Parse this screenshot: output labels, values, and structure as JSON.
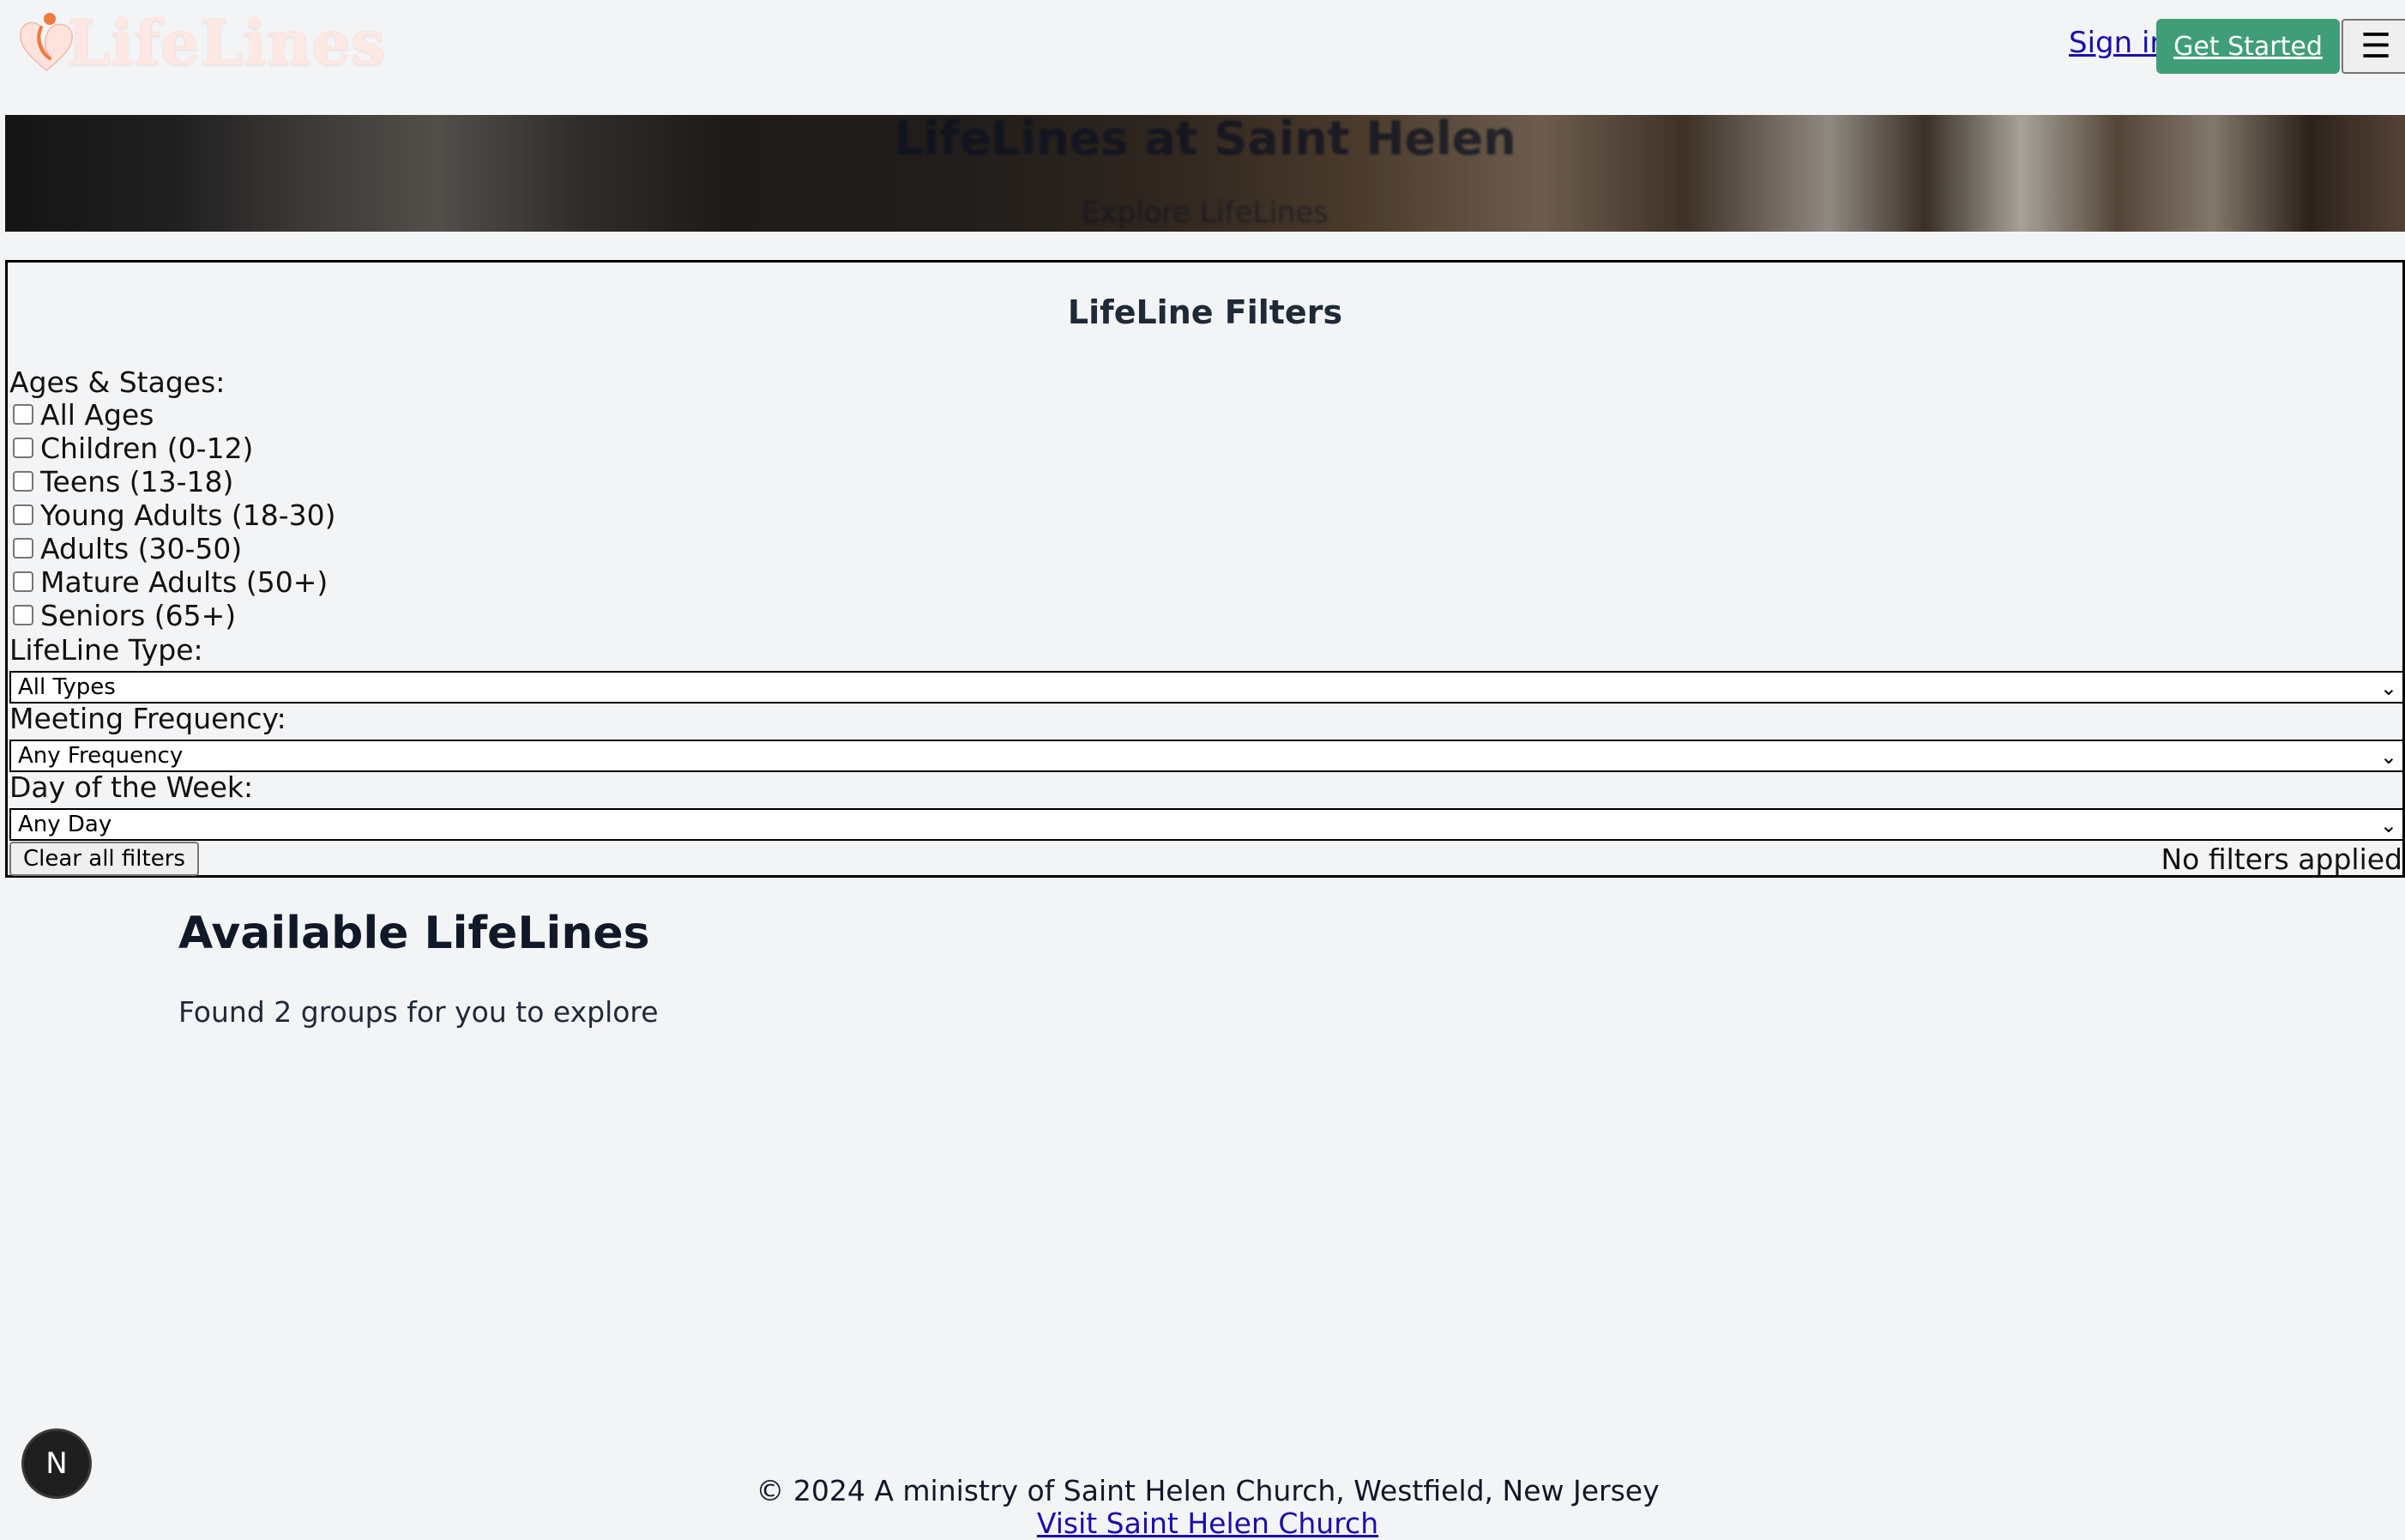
{
  "header": {
    "logo_text": "LifeLines",
    "signin_label": "Sign in",
    "get_started_label": "Get Started",
    "menu_icon": "hamburger-menu-icon"
  },
  "hero": {
    "title": "LifeLines at Saint Helen",
    "subtitle": "Explore LifeLines"
  },
  "filters": {
    "title": "LifeLine Filters",
    "ages_label": "Ages & Stages:",
    "age_options": [
      {
        "label": "All Ages",
        "checked": false
      },
      {
        "label": "Children (0-12)",
        "checked": false
      },
      {
        "label": "Teens (13-18)",
        "checked": false
      },
      {
        "label": "Young Adults (18-30)",
        "checked": false
      },
      {
        "label": "Adults (30-50)",
        "checked": false
      },
      {
        "label": "Mature Adults (50+)",
        "checked": false
      },
      {
        "label": "Seniors (65+)",
        "checked": false
      }
    ],
    "type_label": "LifeLine Type:",
    "type_value": "All Types",
    "frequency_label": "Meeting Frequency:",
    "frequency_value": "Any Frequency",
    "day_label": "Day of the Week:",
    "day_value": "Any Day",
    "clear_label": "Clear all filters",
    "status": "No filters applied"
  },
  "results": {
    "title": "Available LifeLines",
    "count_text": "Found 2 groups for you to explore"
  },
  "footer": {
    "copyright": "© 2024 A ministry of Saint Helen Church, Westfield, New Jersey",
    "link_text": "Visit Saint Helen Church"
  },
  "badge": {
    "letter": "N"
  },
  "colors": {
    "background": "#f3f4f6",
    "accent_green": "#3f9e78",
    "link_blue": "#1a0dab",
    "logo_pink": "#fde8e4",
    "logo_orange": "#f07a3c"
  }
}
